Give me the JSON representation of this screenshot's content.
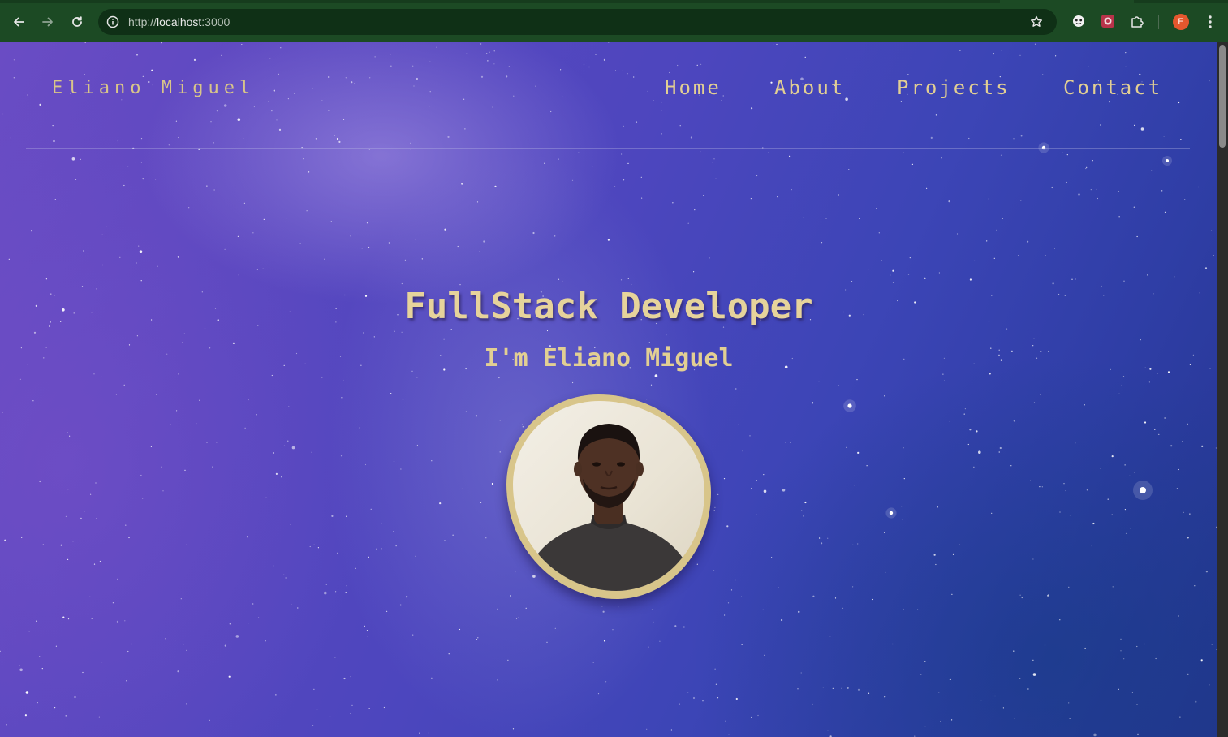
{
  "browser": {
    "url_scheme": "http://",
    "url_host": "localhost",
    "url_port": ":3000",
    "profile_initial": "E",
    "accent_color": "#1c4a24"
  },
  "site": {
    "logo": "Eliano Miguel",
    "nav": {
      "home": "Home",
      "about": "About",
      "projects": "Projects",
      "contact": "Contact"
    },
    "accent_color": "#e2cf93"
  },
  "hero": {
    "title": "FullStack Developer",
    "subtitle": "I'm Eliano Miguel",
    "photo": "profile photo of Eliano Miguel"
  }
}
